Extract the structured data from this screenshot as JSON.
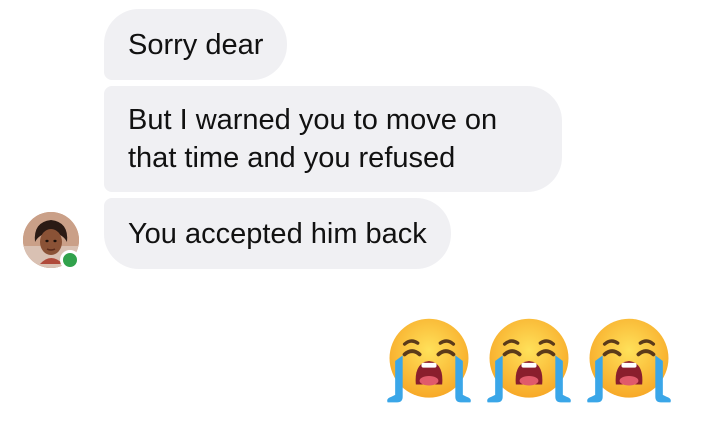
{
  "messages": {
    "incoming": [
      {
        "text": "Sorry dear"
      },
      {
        "text": "But I warned you to move on that time and you refused"
      },
      {
        "text": "You accepted him back"
      }
    ],
    "outgoing_emojis": [
      "loudly-crying-face",
      "loudly-crying-face",
      "loudly-crying-face"
    ]
  },
  "contact": {
    "online": true
  },
  "colors": {
    "incoming_bubble": "#f0f0f3",
    "online_dot": "#31a24c"
  }
}
